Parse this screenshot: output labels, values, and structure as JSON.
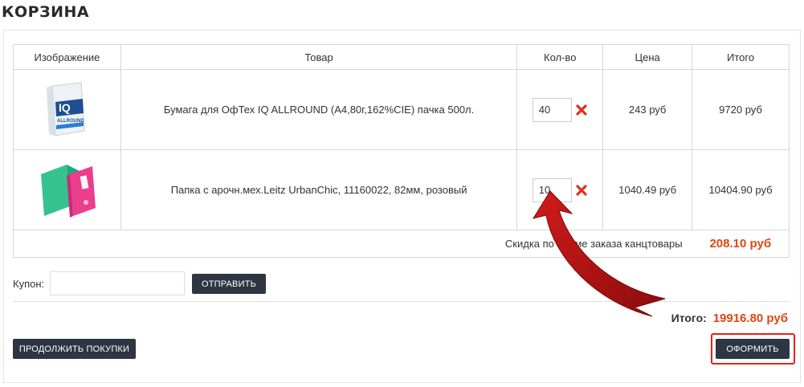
{
  "page": {
    "title": "КОРЗИНА"
  },
  "table": {
    "headers": {
      "image": "Изображение",
      "product": "Товар",
      "qty": "Кол-во",
      "price": "Цена",
      "total": "Итого"
    },
    "items": [
      {
        "name": "Бумага для ОфТех IQ ALLROUND (А4,80г,162%CIE) пачка 500л.",
        "qty": "40",
        "price": "243 руб",
        "total": "9720 руб",
        "image_icon": "paper-pack-iq-icon",
        "image_text": "IQ",
        "image_subtext": "ALLROUND"
      },
      {
        "name": "Папка с арочн.мех.Leitz UrbanChic, 11160022, 82мм, розовый",
        "qty": "10",
        "price": "1040.49 руб",
        "total": "10404.90 руб",
        "image_icon": "lever-arch-folder-icon"
      }
    ],
    "discount": {
      "label": "Скидка по сумме заказа канцтовары",
      "value": "208.10 руб"
    }
  },
  "coupon": {
    "label": "Купон:",
    "value": "",
    "submit_label": "ОТПРАВИТЬ"
  },
  "summary": {
    "total_label": "Итого:",
    "total_value": "19916.80 руб"
  },
  "actions": {
    "continue_label": "ПРОДОЛЖИТЬ ПОКУПКИ",
    "checkout_label": "ОФОРМИТЬ"
  },
  "colors": {
    "accent": "#e0460f",
    "button_bg": "#2d3642",
    "remove": "#e0301a",
    "highlight": "#e8201a",
    "arrow": "#b80f0f"
  }
}
